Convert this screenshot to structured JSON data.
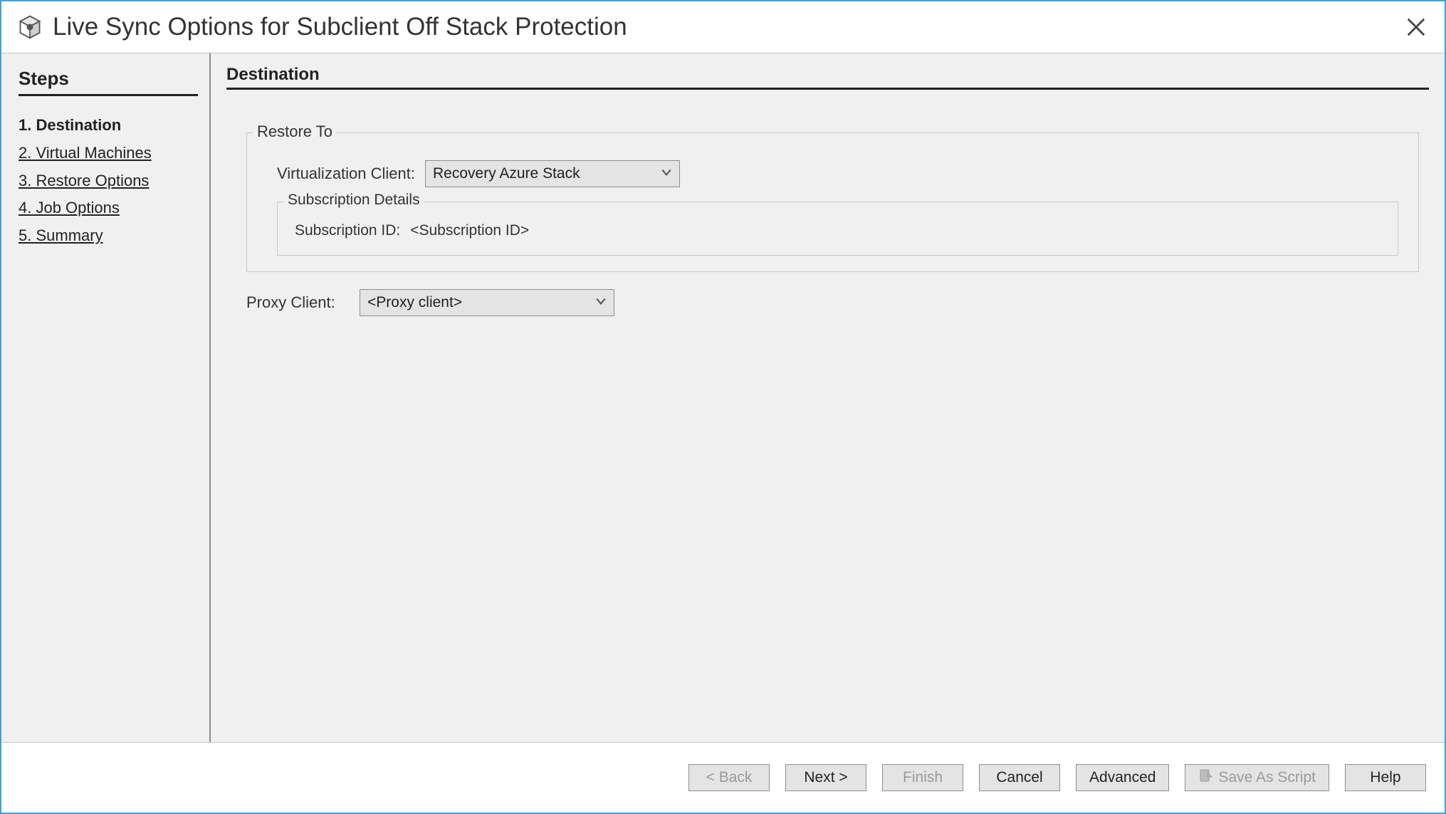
{
  "window": {
    "title": "Live Sync Options for Subclient Off Stack Protection"
  },
  "sidebar": {
    "title": "Steps",
    "items": [
      {
        "label": "1. Destination",
        "active": true
      },
      {
        "label": "2. Virtual Machines",
        "active": false
      },
      {
        "label": "3. Restore Options",
        "active": false
      },
      {
        "label": "4. Job Options",
        "active": false
      },
      {
        "label": "5. Summary",
        "active": false
      }
    ]
  },
  "main": {
    "heading": "Destination",
    "restore_to": {
      "legend": "Restore To",
      "virtualization_client_label": "Virtualization Client:",
      "virtualization_client_value": "Recovery Azure Stack",
      "subscription_details": {
        "legend": "Subscription Details",
        "id_label": "Subscription ID:",
        "id_value": "<Subscription ID>"
      }
    },
    "proxy_client_label": "Proxy Client:",
    "proxy_client_value": "<Proxy client>"
  },
  "footer": {
    "back": "< Back",
    "next": "Next >",
    "finish": "Finish",
    "cancel": "Cancel",
    "advanced": "Advanced",
    "save_as_script": "Save As Script",
    "help": "Help"
  }
}
